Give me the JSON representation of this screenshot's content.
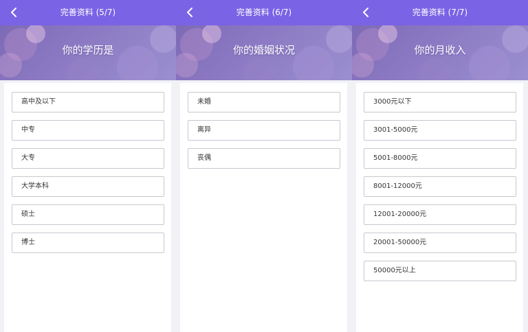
{
  "screens": [
    {
      "title": "完善资料 (5/7)",
      "question": "你的学历是",
      "options": [
        "高中及以下",
        "中专",
        "大专",
        "大学本科",
        "硕士",
        "博士"
      ]
    },
    {
      "title": "完善资料 (6/7)",
      "question": "你的婚姻状况",
      "options": [
        "未婚",
        "离异",
        "丧偶"
      ]
    },
    {
      "title": "完善资料 (7/7)",
      "question": "你的月收入",
      "options": [
        "3000元以下",
        "3001-5000元",
        "5001-8000元",
        "8001-12000元",
        "12001-20000元",
        "20001-50000元",
        "50000元以上"
      ]
    }
  ],
  "icons": {
    "back": "chevron-left-icon"
  },
  "colors": {
    "header": "#7a63e4",
    "banner": "#8c7bc4",
    "option_border": "#c9c6cf",
    "background": "#f1f2f6"
  }
}
